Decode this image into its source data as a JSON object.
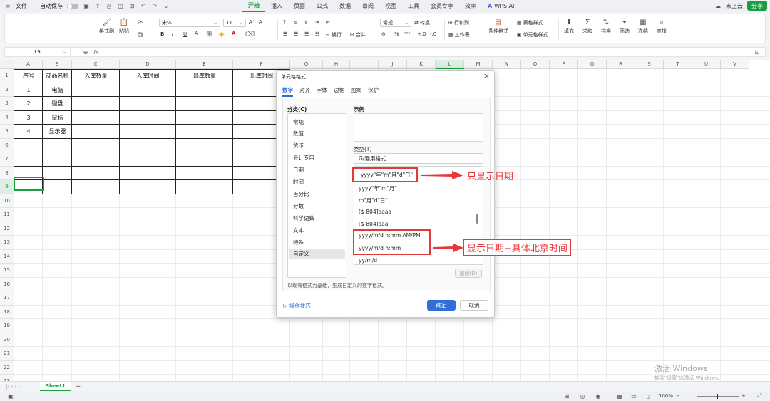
{
  "menubar": {
    "file": "文件",
    "autosave": "自动保存",
    "tabs": [
      "开始",
      "插入",
      "页面",
      "公式",
      "数据",
      "审阅",
      "视图",
      "工具",
      "会员专享",
      "效率"
    ],
    "wps_ai": "WPS AI",
    "cloud": "未上云",
    "share": "分享"
  },
  "ribbon": {
    "format_painter": "格式刷",
    "paste": "粘贴",
    "font_name": "宋体",
    "font_size": "11",
    "wrap": "换行",
    "merge": "合并",
    "number_format": "常规",
    "convert": "转换",
    "row_col": "行和列",
    "worksheet": "工作表",
    "cond_format": "条件格式",
    "table_style": "表格样式",
    "cell_style": "单元格样式",
    "fill": "填充",
    "sum": "求和",
    "sort": "排序",
    "filter": "筛选",
    "freeze": "冻结",
    "find": "查找",
    "bold": "B",
    "italic": "I",
    "underline": "U",
    "font_color": "A",
    "percent": "%"
  },
  "formula_bar": {
    "name_box": "L9",
    "fx": "fx",
    "value": ""
  },
  "columns": [
    "A",
    "B",
    "C",
    "D",
    "E",
    "F",
    "G",
    "H",
    "I",
    "J",
    "K",
    "L",
    "M",
    "N",
    "O",
    "P",
    "Q",
    "R",
    "S",
    "T",
    "U",
    "V"
  ],
  "rows": [
    "1",
    "2",
    "3",
    "4",
    "5",
    "6",
    "7",
    "8",
    "9",
    "10",
    "11",
    "12",
    "13",
    "14",
    "15",
    "16",
    "17",
    "18",
    "19",
    "20",
    "21",
    "22",
    "23"
  ],
  "table": {
    "headers": [
      "序号",
      "商品名称",
      "入库数量",
      "入库时间",
      "出库数量",
      "出库时间"
    ],
    "rows": [
      [
        "1",
        "电脑"
      ],
      [
        "2",
        "键盘"
      ],
      [
        "3",
        "鼠标"
      ],
      [
        "4",
        "显示器"
      ]
    ]
  },
  "sheet": {
    "tab": "Sheet1",
    "add": "+"
  },
  "status": {
    "zoom": "100%"
  },
  "watermark": {
    "line1": "激活 Windows",
    "line2": "转到\"设置\"以激活 Windows。"
  },
  "dialog": {
    "title": "单元格格式",
    "tabs": [
      "数字",
      "对齐",
      "字体",
      "边框",
      "图案",
      "保护"
    ],
    "category_label": "分类(C)",
    "categories": [
      "常规",
      "数值",
      "货币",
      "会计专用",
      "日期",
      "时间",
      "百分比",
      "分数",
      "科学记数",
      "文本",
      "特殊",
      "自定义"
    ],
    "sample_label": "示例",
    "type_label": "类型(T)",
    "type_value": "G/通用格式",
    "formats": [
      "yyyy\"年\"m\"月\"d\"日\"",
      "yyyy\"年\"m\"月\"",
      "m\"月\"d\"日\"",
      "[$-804]aaaa",
      "[$-804]aaa",
      "yyyy/m/d h:mm AM/PM",
      "yyyy/m/d h:mm",
      "yy/m/d"
    ],
    "delete": "删除(D)",
    "description": "以现有格式为基础，生成自定义的数字格式。",
    "tips": "操作技巧",
    "ok": "确定",
    "cancel": "取消"
  },
  "annotations": {
    "date_only": "只显示日期",
    "date_time": "显示日期+具体北京时间"
  },
  "colors": {
    "accent": "#1a9e3f",
    "dialog_blue": "#2f6fd6",
    "annotation": "#e5383b"
  }
}
